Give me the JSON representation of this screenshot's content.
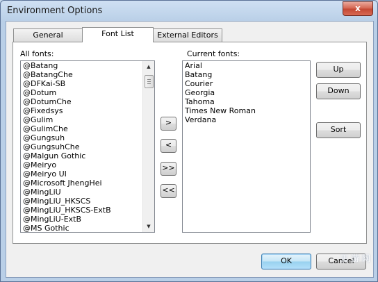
{
  "window": {
    "title": "Environment Options",
    "close_label": "x"
  },
  "tabs": [
    {
      "label": "General",
      "active": false
    },
    {
      "label": "Font List",
      "active": true
    },
    {
      "label": "External Editors",
      "active": false
    }
  ],
  "all_fonts": {
    "label": "All fonts:",
    "items": [
      "@Batang",
      "@BatangChe",
      "@DFKai-SB",
      "@Dotum",
      "@DotumChe",
      "@Fixedsys",
      "@Gulim",
      "@GulimChe",
      "@Gungsuh",
      "@GungsuhChe",
      "@Malgun Gothic",
      "@Meiryo",
      "@Meiryo UI",
      "@Microsoft JhengHei",
      "@MingLiU",
      "@MingLiU_HKSCS",
      "@MingLiU_HKSCS-ExtB",
      "@MingLiU-ExtB",
      "@MS Gothic"
    ],
    "scroll_up": "▲",
    "scroll_down": "▼"
  },
  "current_fonts": {
    "label": "Current fonts:",
    "items": [
      "Arial",
      "Batang",
      "Courier",
      "Georgia",
      "Tahoma",
      "Times New Roman",
      "Verdana"
    ]
  },
  "transfer_buttons": {
    "add": ">",
    "remove": "<",
    "add_all": ">>",
    "remove_all": "<<"
  },
  "side_buttons": {
    "up": "Up",
    "down": "Down",
    "sort": "Sort"
  },
  "footer": {
    "ok": "OK",
    "cancel": "Cancel"
  },
  "watermark": "王 游 网"
}
